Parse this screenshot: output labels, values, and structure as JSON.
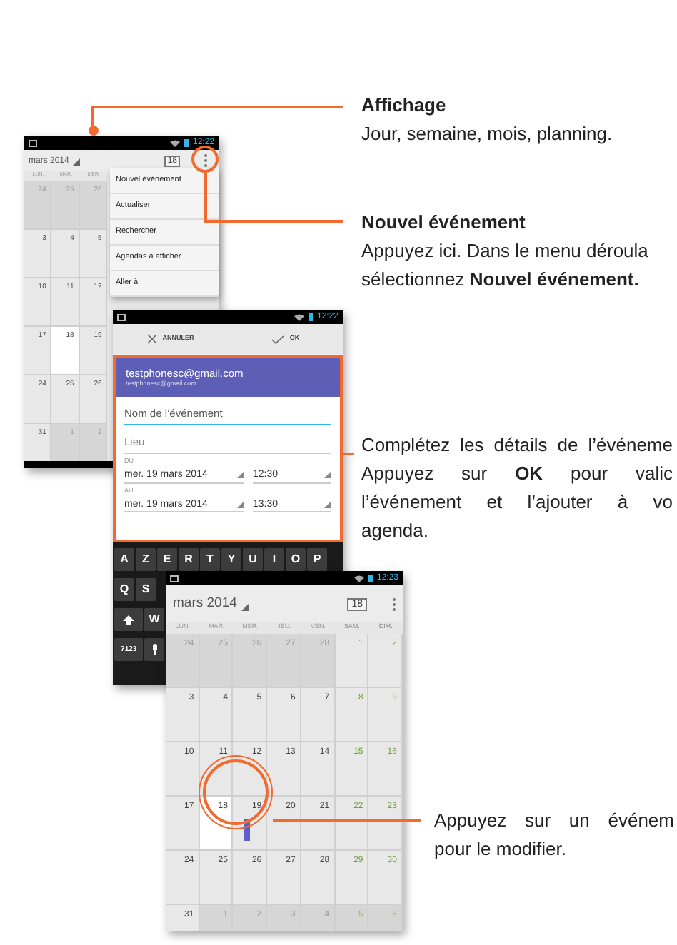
{
  "callouts": [
    {
      "title": "Affichage",
      "lines": [
        "Jour, semaine, mois, planning."
      ]
    },
    {
      "title": "Nouvel événement",
      "justified": false,
      "lines": [
        "Appuyez ici. Dans le menu déroula",
        "sélectionnez **Nouvel événement.**"
      ]
    },
    {
      "justified": true,
      "lines": [
        "Complétez les détails de l’événeme",
        "Appuyez sur **OK** pour valic",
        "l’événement et l’ajouter à vo",
        "agenda."
      ]
    },
    {
      "justified": true,
      "lines": [
        "Appuyez sur un événem",
        "pour le modifier."
      ]
    }
  ],
  "month_screen": {
    "time": "12:22",
    "month": "mars 2014",
    "today_label": "18",
    "weekdays": [
      {
        "label": "LUN.",
        "weekend": false
      },
      {
        "label": "MAR.",
        "weekend": false
      },
      {
        "label": "MER.",
        "weekend": false
      }
    ],
    "weeks": [
      [
        {
          "day": "24",
          "in_month": false,
          "today": false
        },
        {
          "day": "25",
          "in_month": false,
          "today": false
        },
        {
          "day": "26",
          "in_month": false,
          "today": false
        }
      ],
      [
        {
          "day": "3",
          "in_month": true,
          "today": false
        },
        {
          "day": "4",
          "in_month": true,
          "today": false
        },
        {
          "day": "5",
          "in_month": true,
          "today": false
        }
      ],
      [
        {
          "day": "10",
          "in_month": true,
          "today": false
        },
        {
          "day": "11",
          "in_month": true,
          "today": false
        },
        {
          "day": "12",
          "in_month": true,
          "today": false
        }
      ],
      [
        {
          "day": "17",
          "in_month": true,
          "today": false
        },
        {
          "day": "18",
          "in_month": true,
          "today": true
        },
        {
          "day": "19",
          "in_month": true,
          "today": false
        }
      ],
      [
        {
          "day": "24",
          "in_month": true,
          "today": false
        },
        {
          "day": "25",
          "in_month": true,
          "today": false
        },
        {
          "day": "26",
          "in_month": true,
          "today": false
        }
      ],
      [
        {
          "day": "31",
          "in_month": true,
          "today": false
        },
        {
          "day": "1",
          "in_month": false,
          "today": false
        },
        {
          "day": "2",
          "in_month": false,
          "today": false
        }
      ]
    ],
    "menu": [
      "Nouvel événement",
      "Actualiser",
      "Rechercher",
      "Agendas à afficher",
      "Aller à"
    ]
  },
  "event_screen": {
    "time": "12:22",
    "cancel": "ANNULER",
    "ok": "OK",
    "account_name": "testphonesc@gmail.com",
    "account_email": "testphonesc@gmail.com",
    "name_placeholder": "Nom de l’événement",
    "location_placeholder": "Lieu",
    "from_label": "DU",
    "from_date": "mer. 19 mars 2014",
    "from_time": "12:30",
    "to_label": "AU",
    "to_date": "mer. 19 mars 2014",
    "to_time": "13:30",
    "keyboard": [
      [
        {
          "kind": "letter",
          "label": "A"
        },
        {
          "kind": "letter",
          "label": "Z"
        },
        {
          "kind": "letter",
          "label": "E"
        },
        {
          "kind": "letter",
          "label": "R"
        },
        {
          "kind": "letter",
          "label": "T"
        },
        {
          "kind": "letter",
          "label": "Y"
        },
        {
          "kind": "letter",
          "label": "U"
        },
        {
          "kind": "letter",
          "label": "I"
        },
        {
          "kind": "letter",
          "label": "O"
        },
        {
          "kind": "letter",
          "label": "P"
        }
      ],
      [
        {
          "kind": "letter",
          "label": "Q"
        },
        {
          "kind": "letter",
          "label": "S"
        }
      ],
      [
        {
          "kind": "shift"
        },
        {
          "kind": "letter",
          "label": "W"
        }
      ],
      [
        {
          "kind": "letter",
          "label": "?123"
        },
        {
          "kind": "mic"
        }
      ]
    ]
  },
  "calendar_screen": {
    "time": "12:23",
    "month": "mars 2014",
    "today_label": "18",
    "weekdays": [
      {
        "label": "LUN.",
        "weekend": false
      },
      {
        "label": "MAR.",
        "weekend": false
      },
      {
        "label": "MER.",
        "weekend": false
      },
      {
        "label": "JEU.",
        "weekend": false
      },
      {
        "label": "VEN.",
        "weekend": false
      },
      {
        "label": "SAM.",
        "weekend": true
      },
      {
        "label": "DIM.",
        "weekend": true
      }
    ],
    "weeks": [
      [
        {
          "day": "24",
          "in_month": false,
          "today": false,
          "event": false
        },
        {
          "day": "25",
          "in_month": false,
          "today": false,
          "event": false
        },
        {
          "day": "26",
          "in_month": false,
          "today": false,
          "event": false
        },
        {
          "day": "27",
          "in_month": false,
          "today": false,
          "event": false
        },
        {
          "day": "28",
          "in_month": false,
          "today": false,
          "event": false
        },
        {
          "day": "1",
          "in_month": true,
          "today": false,
          "event": false
        },
        {
          "day": "2",
          "in_month": true,
          "today": false,
          "event": false
        }
      ],
      [
        {
          "day": "3",
          "in_month": true,
          "today": false,
          "event": false
        },
        {
          "day": "4",
          "in_month": true,
          "today": false,
          "event": false
        },
        {
          "day": "5",
          "in_month": true,
          "today": false,
          "event": false
        },
        {
          "day": "6",
          "in_month": true,
          "today": false,
          "event": false
        },
        {
          "day": "7",
          "in_month": true,
          "today": false,
          "event": false
        },
        {
          "day": "8",
          "in_month": true,
          "today": false,
          "event": false
        },
        {
          "day": "9",
          "in_month": true,
          "today": false,
          "event": false
        }
      ],
      [
        {
          "day": "10",
          "in_month": true,
          "today": false,
          "event": false
        },
        {
          "day": "11",
          "in_month": true,
          "today": false,
          "event": false
        },
        {
          "day": "12",
          "in_month": true,
          "today": false,
          "event": false
        },
        {
          "day": "13",
          "in_month": true,
          "today": false,
          "event": false
        },
        {
          "day": "14",
          "in_month": true,
          "today": false,
          "event": false
        },
        {
          "day": "15",
          "in_month": true,
          "today": false,
          "event": false
        },
        {
          "day": "16",
          "in_month": true,
          "today": false,
          "event": false
        }
      ],
      [
        {
          "day": "17",
          "in_month": true,
          "today": false,
          "event": false
        },
        {
          "day": "18",
          "in_month": true,
          "today": true,
          "event": false
        },
        {
          "day": "19",
          "in_month": true,
          "today": false,
          "event": true
        },
        {
          "day": "20",
          "in_month": true,
          "today": false,
          "event": false
        },
        {
          "day": "21",
          "in_month": true,
          "today": false,
          "event": false
        },
        {
          "day": "22",
          "in_month": true,
          "today": false,
          "event": false
        },
        {
          "day": "23",
          "in_month": true,
          "today": false,
          "event": false
        }
      ],
      [
        {
          "day": "24",
          "in_month": true,
          "today": false,
          "event": false
        },
        {
          "day": "25",
          "in_month": true,
          "today": false,
          "event": false
        },
        {
          "day": "26",
          "in_month": true,
          "today": false,
          "event": false
        },
        {
          "day": "27",
          "in_month": true,
          "today": false,
          "event": false
        },
        {
          "day": "28",
          "in_month": true,
          "today": false,
          "event": false
        },
        {
          "day": "29",
          "in_month": true,
          "today": false,
          "event": false
        },
        {
          "day": "30",
          "in_month": true,
          "today": false,
          "event": false
        }
      ],
      [
        {
          "day": "31",
          "in_month": true,
          "today": false,
          "event": false
        },
        {
          "day": "1",
          "in_month": false,
          "today": false,
          "event": false
        },
        {
          "day": "2",
          "in_month": false,
          "today": false,
          "event": false
        },
        {
          "day": "3",
          "in_month": false,
          "today": false,
          "event": false
        },
        {
          "day": "4",
          "in_month": false,
          "today": false,
          "event": false
        },
        {
          "day": "5",
          "in_month": false,
          "today": false,
          "event": false
        },
        {
          "day": "6",
          "in_month": false,
          "today": false,
          "event": false
        }
      ]
    ]
  }
}
